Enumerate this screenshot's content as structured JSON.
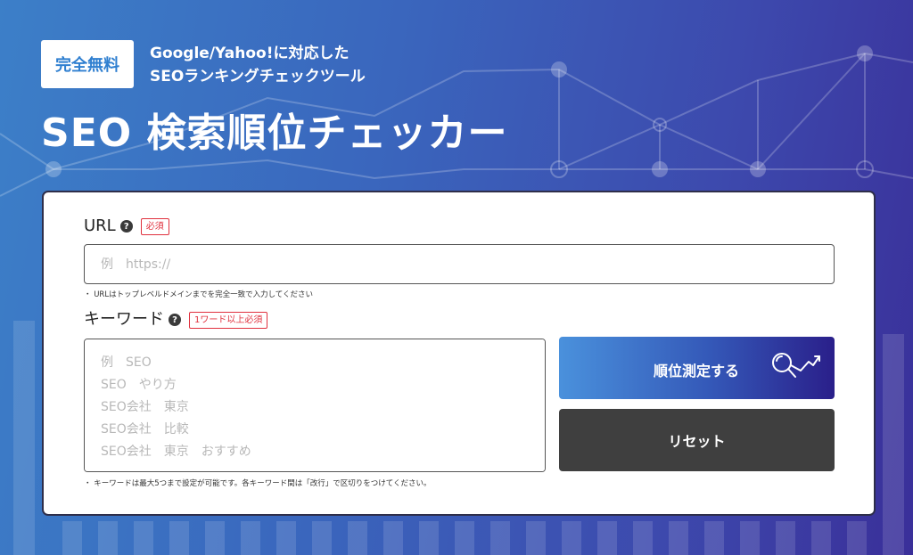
{
  "header": {
    "badge": "完全無料",
    "subtitle_line1": "Google/Yahoo!に対応した",
    "subtitle_line2": "SEOランキングチェックツール",
    "title": "SEO 検索順位チェッカー"
  },
  "form": {
    "url": {
      "label": "URL",
      "help": "?",
      "required_tag": "必須",
      "placeholder": "例　https://",
      "note": "・ URLはトップレベルドメインまでを完全一致で入力してください"
    },
    "keyword": {
      "label": "キーワード",
      "help": "?",
      "required_tag": "1ワード以上必須",
      "placeholder": "例　SEO\nSEO　やり方\nSEO会社　東京\nSEO会社　比較\nSEO会社　東京　おすすめ",
      "note": "・ キーワードは最大5つまで設定が可能です。各キーワード間は「改行」で区切りをつけてください。"
    },
    "buttons": {
      "measure": "順位測定する",
      "reset": "リセット"
    }
  },
  "colors": {
    "badge_text": "#2f7fd0",
    "required": "#e0313e",
    "reset_button": "#3f3f3f",
    "background_start": "#3c7fc8",
    "background_end": "#3a2f99"
  }
}
